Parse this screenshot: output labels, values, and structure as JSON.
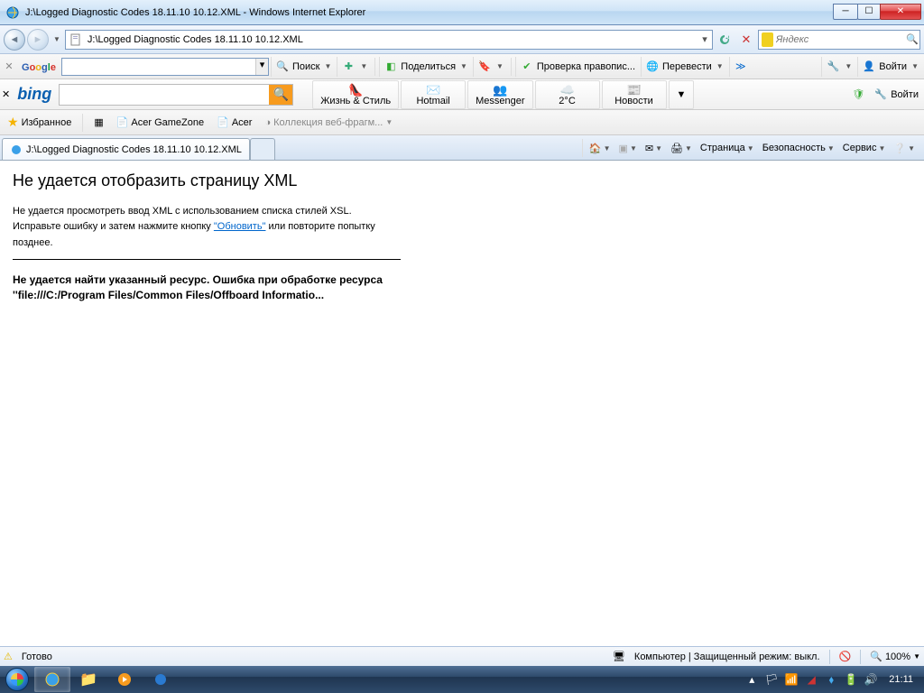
{
  "window": {
    "title": "J:\\Logged Diagnostic Codes 18.11.10 10.12.XML - Windows Internet Explorer"
  },
  "nav": {
    "address": "J:\\Logged Diagnostic Codes 18.11.10 10.12.XML",
    "search_placeholder": "Яндекс"
  },
  "google_toolbar": {
    "search_label": "Поиск",
    "share_label": "Поделиться",
    "spellcheck_label": "Проверка правопис...",
    "translate_label": "Перевести",
    "more_label": "",
    "settings_label": "",
    "login_label": "Войти"
  },
  "bing_toolbar": {
    "tiles": {
      "life": "Жизнь & Стиль",
      "hotmail": "Hotmail",
      "messenger": "Messenger",
      "weather": "2°C",
      "news": "Новости"
    },
    "login_label": "Войти"
  },
  "favbar": {
    "fav_label": "Избранное",
    "acer_gamezone": "Acer GameZone",
    "acer": "Acer",
    "webfrag": "Коллекция веб-фрагм..."
  },
  "tab": {
    "title": "J:\\Logged Diagnostic Codes 18.11.10 10.12.XML"
  },
  "cmdbar": {
    "page": "Страница",
    "security": "Безопасность",
    "service": "Сервис"
  },
  "page": {
    "heading": "Не удается отобразить страницу XML",
    "message_pre": "Не удается просмотреть ввод XML с использованием списка стилей XSL. Исправьте ошибку и затем нажмите кнопку ",
    "refresh_link": "\"Обновить\"",
    "message_post": " или повторите попытку позднее.",
    "error": "Не удается найти указанный ресурс. Ошибка при обработке ресурса ''file:///C:/Program Files/Common Files/Offboard Informatio..."
  },
  "status": {
    "ready": "Готово",
    "zone": "Компьютер | Защищенный режим: выкл.",
    "zoom": "100%"
  },
  "taskbar": {
    "time": "21:11"
  }
}
